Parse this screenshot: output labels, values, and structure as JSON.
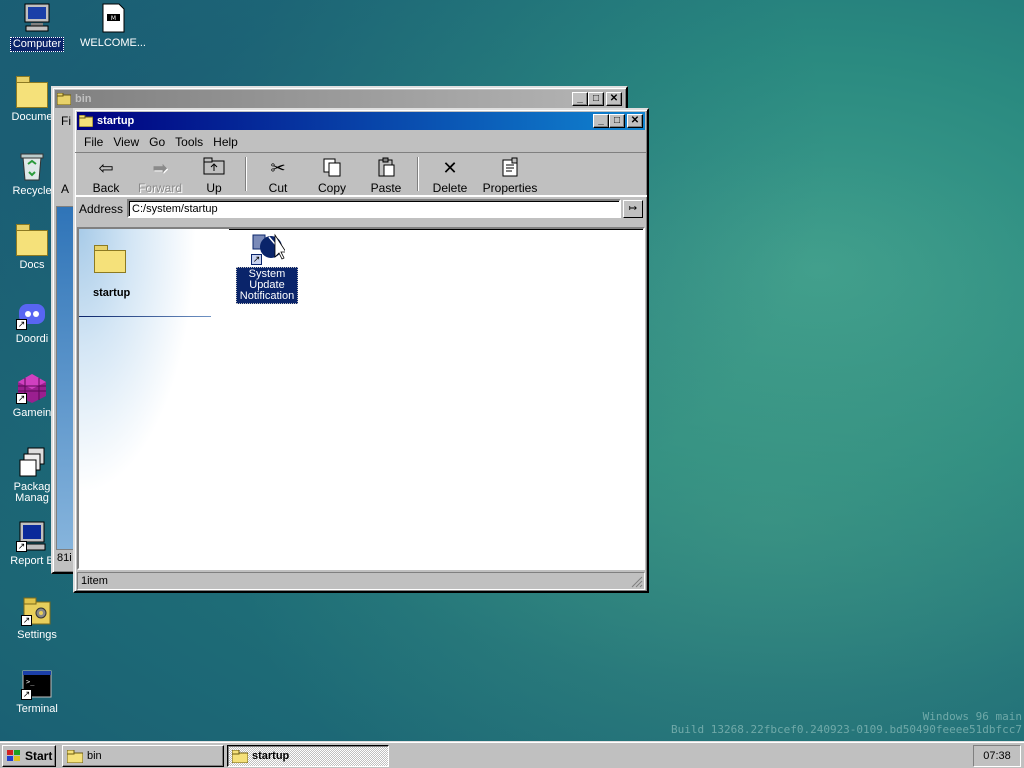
{
  "desktop": {
    "icons": [
      {
        "label": "Computer",
        "icon": "computer-icon"
      },
      {
        "label": "WELCOME...",
        "icon": "markdown-file-icon"
      },
      {
        "label": "Docume",
        "icon": "folder-icon"
      },
      {
        "label": "Recycle",
        "icon": "recycle-bin-icon"
      },
      {
        "label": "Docs",
        "icon": "folder-icon"
      },
      {
        "label": "Doordi",
        "icon": "discord-icon"
      },
      {
        "label": "Gamein",
        "icon": "game-icon"
      },
      {
        "label": "Packag\nManag",
        "icon": "package-manager-icon"
      },
      {
        "label": "Report B",
        "icon": "report-icon"
      },
      {
        "label": "Settings",
        "icon": "settings-icon"
      },
      {
        "label": "Terminal",
        "icon": "terminal-icon"
      }
    ],
    "watermark_line1": "Windows 96 main",
    "watermark_line2": "Build 13268.22fbcef0.240923-0109.bd50490feeee51dbfcc7"
  },
  "bin_window": {
    "title": "bin",
    "menu_fragment": "Fi",
    "address_fragment": "A",
    "status_fragment": "81i"
  },
  "startup_window": {
    "title": "startup",
    "menu": [
      "File",
      "View",
      "Go",
      "Tools",
      "Help"
    ],
    "toolbar": {
      "back": "Back",
      "forward": "Forward",
      "up": "Up",
      "cut": "Cut",
      "copy": "Copy",
      "paste": "Paste",
      "delete": "Delete",
      "properties": "Properties"
    },
    "address_label": "Address",
    "address_value": "C:/system/startup",
    "address_go": "↦",
    "sidebar_title": "startup",
    "files": [
      {
        "label": "System\nUpdate\nNotification",
        "icon": "shortcut-app-icon",
        "selected": true
      }
    ],
    "status": "1item"
  },
  "taskbar": {
    "start_label": "Start",
    "tasks": [
      {
        "label": "bin",
        "active": false
      },
      {
        "label": "startup",
        "active": true
      }
    ],
    "clock": "07:38"
  },
  "colors": {
    "titlebar_active": "#000080",
    "selection": "#0a246a",
    "window_face": "#c0c0c0",
    "desktop": "#2a8a80"
  }
}
